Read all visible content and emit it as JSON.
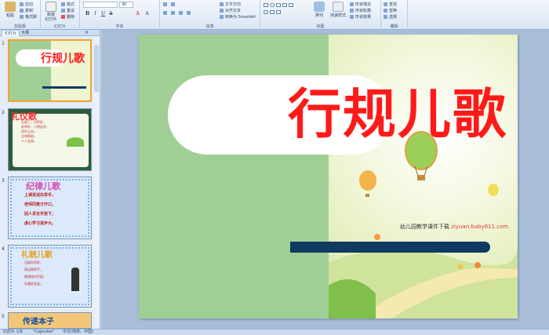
{
  "ribbon": {
    "groups": {
      "clipboard": "剪贴板",
      "slides": "幻灯片",
      "font": "字体",
      "paragraph": "段落",
      "drawing": "绘图",
      "editing": "编辑"
    },
    "paste": "粘贴",
    "cut": "剪切",
    "copy": "复制",
    "format_painter": "格式刷",
    "new_slide": "新建\n幻灯片",
    "layout": "版式",
    "reset": "重设",
    "delete": "删除",
    "font_size": "30",
    "text_direction": "文字方向",
    "align_text": "对齐文本",
    "smartart": "转换为 SmartArt",
    "arrange": "排列",
    "quick_styles": "快速样式",
    "shape_fill": "形状填充",
    "shape_outline": "形状轮廓",
    "shape_effects": "形状效果",
    "find": "查找",
    "replace": "替换",
    "select": "选择"
  },
  "panel": {
    "tab_slides": "幻灯片",
    "tab_outline": "大纲",
    "close": "×",
    "slides": [
      {
        "num": "1",
        "title": "行规儿歌"
      },
      {
        "num": "2",
        "title": "礼仪歌",
        "lines": [
          "见面了，问声好，",
          "老师好，小朋友好，",
          "同学之间，",
          "互相帮助，",
          "人人友爱。"
        ]
      },
      {
        "num": "3",
        "title": "纪律儿歌",
        "lines": [
          "上课说话先举手，",
          "老师同意才开口，",
          "别人发言手放下，",
          "虚心学习进步大。"
        ]
      },
      {
        "num": "4",
        "title": "礼貌儿歌",
        "lines": [
          "见面问声好，",
          "再见挥挥手，",
          "做错说对不起，",
          "礼貌好宝宝。"
        ]
      },
      {
        "num": "5",
        "title": "传递本子"
      }
    ]
  },
  "slide": {
    "title": "行规儿歌",
    "watermark": "幼儿园教学课件下载",
    "watermark_url": "ziyuan.baby611.com"
  },
  "status": {
    "slide_info": "幻灯片 1/8",
    "theme": "\"Capsules\"",
    "language": "中文(简体，中国)"
  },
  "colors": {
    "title_red": "#ff1a1a",
    "slide_green": "#9fcf95",
    "bar_navy": "#0f3a62",
    "ribbon_blue": "#dbe6f4"
  }
}
